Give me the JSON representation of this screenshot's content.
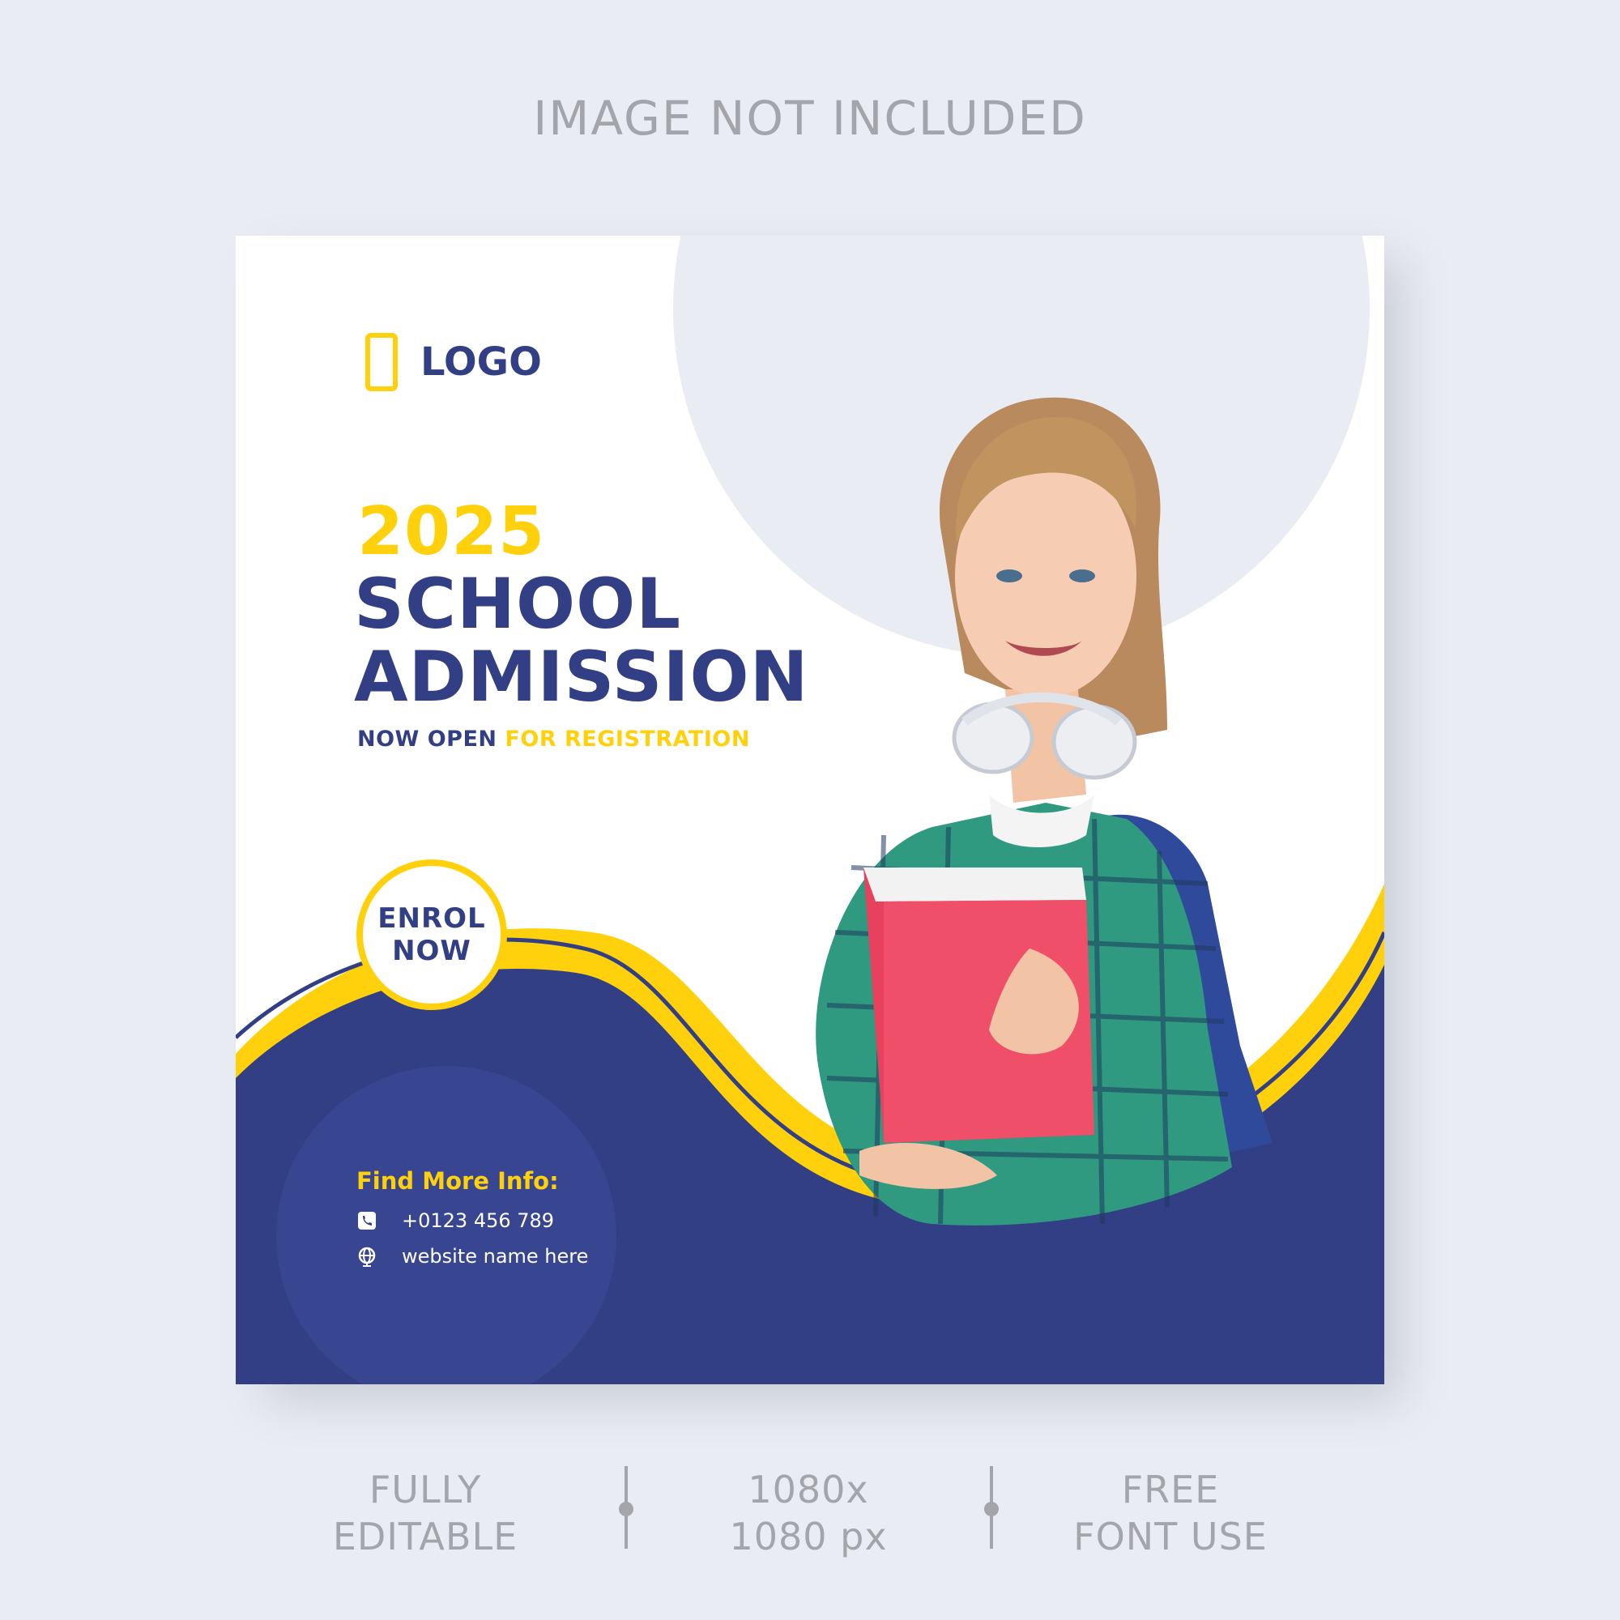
{
  "header_note": "IMAGE NOT INCLUDED",
  "colors": {
    "navy": "#323f85",
    "yellow": "#ffd10c",
    "background": "#e9ecf2",
    "muted_text": "#a3a5aa"
  },
  "flyer": {
    "logo": {
      "icon": "rectangle-logo-icon",
      "text": "LOGO"
    },
    "year": "2025",
    "title_line1": "SCHOOL",
    "title_line2": "ADMISSION",
    "subtitle_part1": "NOW OPEN",
    "subtitle_part2": "FOR REGISTRATION",
    "cta_line1": "ENROL",
    "cta_line2": "NOW",
    "info": {
      "title": "Find More Info:",
      "phone_icon": "phone-icon",
      "phone": "+0123 456 789",
      "web_icon": "globe-icon",
      "website": "website name here"
    },
    "photo": {
      "subject": "student-holding-pink-folder-photo"
    }
  },
  "badges": {
    "b1_line1": "FULLY",
    "b1_line2": "EDITABLE",
    "b2_line1": "1080x",
    "b2_line2": "1080 px",
    "b3_line1": "FREE",
    "b3_line2": "FONT USE"
  }
}
